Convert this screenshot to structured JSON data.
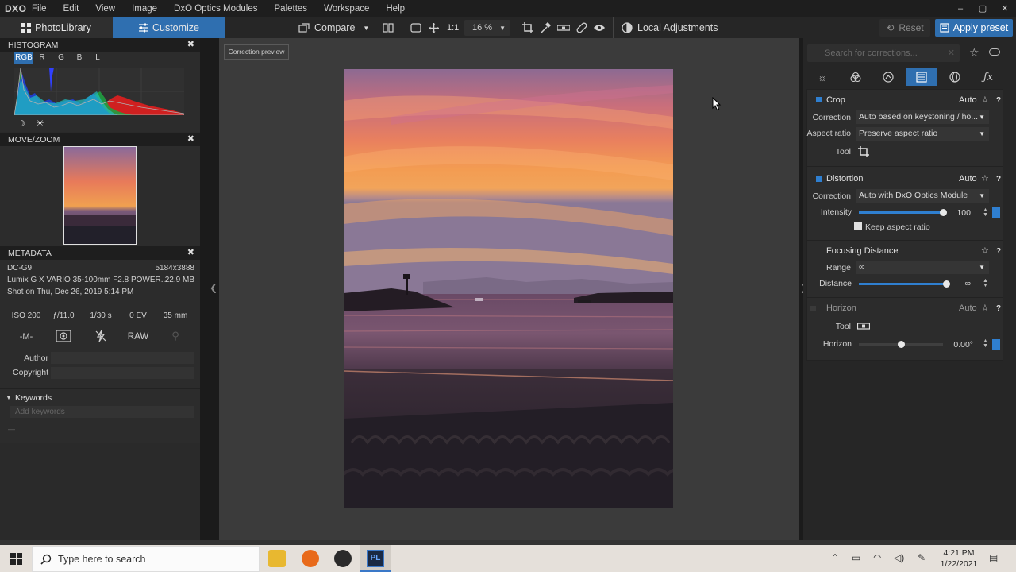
{
  "app": {
    "logo": "DXO",
    "menu": [
      "File",
      "Edit",
      "View",
      "Image",
      "DxO Optics Modules",
      "Palettes",
      "Workspace",
      "Help"
    ],
    "window_controls": [
      "–",
      "▢",
      "✕"
    ]
  },
  "toolbar": {
    "tab_photolibrary": "PhotoLibrary",
    "tab_customize": "Customize",
    "compare_label": "Compare",
    "one_to_one": "1:1",
    "zoom": "16 %",
    "local_adjustments": "Local Adjustments",
    "reset_label": "Reset",
    "apply_preset_label": "Apply preset"
  },
  "histogram": {
    "title": "HISTOGRAM",
    "channels": [
      "RGB",
      "R",
      "G",
      "B",
      "L"
    ],
    "active_channel": "RGB"
  },
  "movezoom": {
    "title": "MOVE/ZOOM"
  },
  "metadata": {
    "title": "METADATA",
    "camera": "DC-G9",
    "resolution": "5184x3888",
    "lens": "Lumix G X VARIO 35-100mm F2.8 POWER...",
    "filesize": "22.9 MB",
    "shot_on": "Shot on Thu, Dec 26, 2019 5:14 PM",
    "iso": "ISO 200",
    "aperture": "ƒ/11.0",
    "shutter": "1/30 s",
    "ev": "0 EV",
    "focal": "35 mm",
    "mode": "-M-",
    "format": "RAW",
    "author_label": "Author",
    "copyright_label": "Copyright",
    "keywords_title": "Keywords",
    "keywords_placeholder": "Add keywords",
    "keywords_dash": "—"
  },
  "viewer": {
    "correction_preview": "Correction preview"
  },
  "corrections": {
    "search_placeholder": "Search for corrections...",
    "crop": {
      "title": "Crop",
      "auto": "Auto",
      "correction_label": "Correction",
      "correction_value": "Auto based on keystoning / ho...",
      "aspect_label": "Aspect ratio",
      "aspect_value": "Preserve aspect ratio",
      "tool_label": "Tool"
    },
    "distortion": {
      "title": "Distortion",
      "auto": "Auto",
      "correction_label": "Correction",
      "correction_value": "Auto with DxO Optics Module",
      "intensity_label": "Intensity",
      "intensity_value": "100",
      "intensity_fraction": 0.96,
      "keep_aspect_label": "Keep aspect ratio"
    },
    "focusing": {
      "title": "Focusing Distance",
      "range_label": "Range",
      "range_value": "∞",
      "distance_label": "Distance",
      "distance_value": "∞",
      "distance_fraction": 1.0
    },
    "horizon": {
      "title": "Horizon",
      "auto": "Auto",
      "tool_label": "Tool",
      "horizon_label": "Horizon",
      "horizon_value": "0.00°",
      "horizon_fraction": 0.5
    }
  },
  "taskbar": {
    "search_placeholder": "Type here to search",
    "time": "4:21 PM",
    "date": "1/22/2021"
  },
  "colors": {
    "accent": "#2f6fb0",
    "panel": "#2c2c2c",
    "viewer_bg": "#3b3b3b"
  }
}
